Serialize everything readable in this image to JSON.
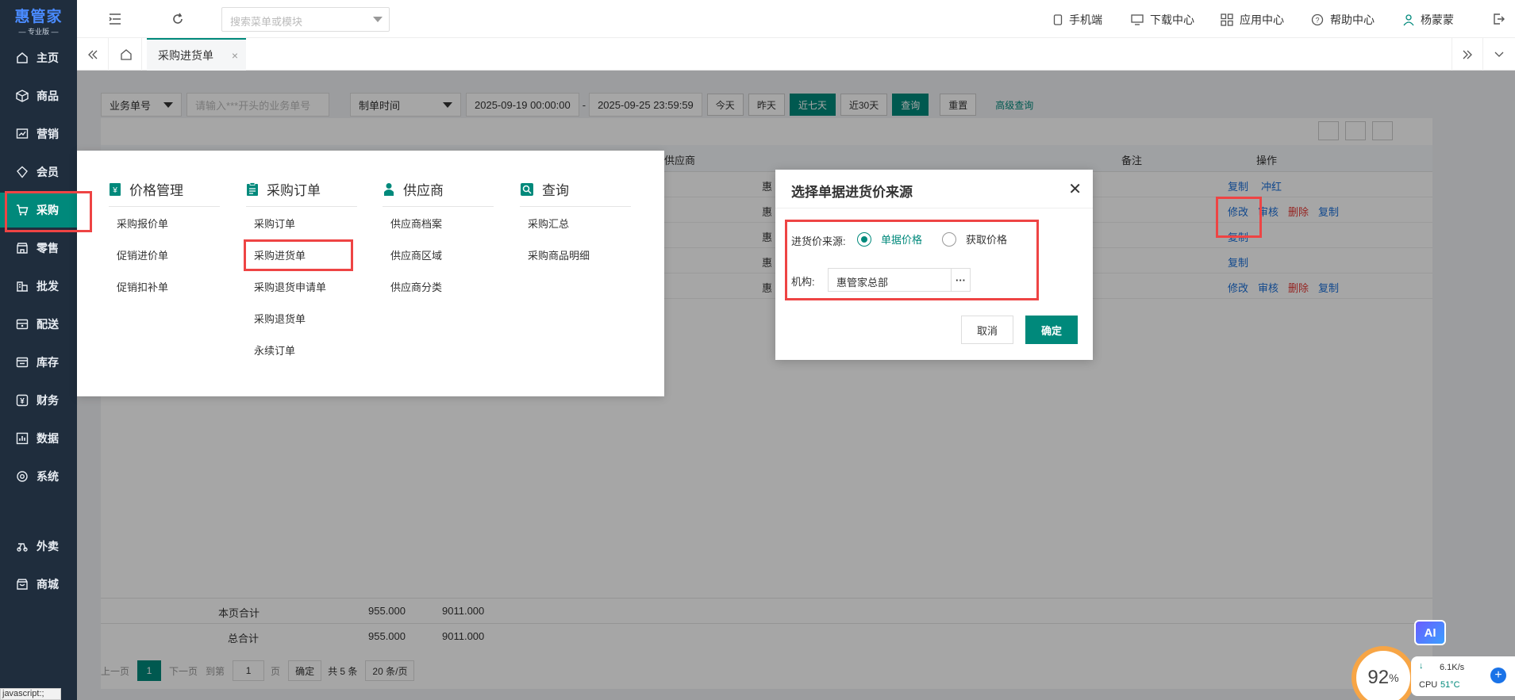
{
  "app": {
    "logo_main": "惠管家",
    "logo_sub": "— 专业版 —"
  },
  "sidebar": {
    "items": [
      {
        "label": "主页",
        "icon": "home-icon"
      },
      {
        "label": "商品",
        "icon": "box-icon"
      },
      {
        "label": "营销",
        "icon": "chart-icon"
      },
      {
        "label": "会员",
        "icon": "diamond-icon"
      },
      {
        "label": "采购",
        "icon": "cart-icon",
        "active": true
      },
      {
        "label": "零售",
        "icon": "shop-icon"
      },
      {
        "label": "批发",
        "icon": "building-icon"
      },
      {
        "label": "配送",
        "icon": "truck-icon"
      },
      {
        "label": "库存",
        "icon": "warehouse-icon"
      },
      {
        "label": "财务",
        "icon": "finance-icon"
      },
      {
        "label": "数据",
        "icon": "data-icon"
      },
      {
        "label": "系统",
        "icon": "settings-icon"
      },
      {
        "label": "外卖",
        "icon": "delivery-icon"
      },
      {
        "label": "商城",
        "icon": "mall-icon"
      }
    ]
  },
  "topbar": {
    "search_placeholder": "搜索菜单或模块",
    "mobile": "手机端",
    "downloads": "下载中心",
    "apps": "应用中心",
    "help": "帮助中心",
    "user": "杨蒙蒙"
  },
  "tabs": {
    "active": "采购进货单"
  },
  "filters": {
    "bill_field": "业务单号",
    "bill_placeholder": "请输入***开头的业务单号",
    "time_field": "制单时间",
    "start": "2025-09-19 00:00:00",
    "dash": "-",
    "end": "2025-09-25 23:59:59",
    "today": "今天",
    "yesterday": "昨天",
    "last7": "近七天",
    "last30": "近30天",
    "query": "查询",
    "reset": "重置",
    "advanced": "高级查询"
  },
  "table": {
    "headers": {
      "supplier": "供应商",
      "remark": "备注",
      "ops": "操作"
    },
    "row_prefix": "惠",
    "ops": {
      "copy": "复制",
      "reverse": "冲红",
      "edit": "修改",
      "audit": "审核",
      "delete": "删除"
    },
    "page_total_label": "本页合计",
    "grand_total_label": "总合计",
    "qty_total": "955.000",
    "amount_total": "9011.000"
  },
  "pager": {
    "prev": "上一页",
    "page": "1",
    "next": "下一页",
    "goto": "到第",
    "goto_val": "1",
    "page_unit": "页",
    "confirm": "确定",
    "total": "共 5 条",
    "size": "20 条/页"
  },
  "mega_menu": {
    "columns": [
      {
        "title": "价格管理",
        "icon": "price-icon",
        "items": [
          "采购报价单",
          "促销进价单",
          "促销扣补单"
        ]
      },
      {
        "title": "采购订单",
        "icon": "clipboard-icon",
        "items": [
          "采购订单",
          "采购进货单",
          "采购退货申请单",
          "采购退货单",
          "永续订单"
        ]
      },
      {
        "title": "供应商",
        "icon": "person-icon",
        "items": [
          "供应商档案",
          "供应商区域",
          "供应商分类"
        ]
      },
      {
        "title": "查询",
        "icon": "search-icon",
        "items": [
          "采购汇总",
          "采购商品明细"
        ]
      }
    ]
  },
  "modal": {
    "title": "选择单据进货价来源",
    "source_label": "进货价来源:",
    "opt_bill": "单据价格",
    "opt_fetch": "获取价格",
    "org_label": "机构:",
    "org_value": "惠管家总部",
    "more": "···",
    "cancel": "取消",
    "ok": "确定"
  },
  "widgets": {
    "ai": "AI",
    "gauge_value": "92",
    "gauge_unit": "%",
    "net_speed": "6.1K/s",
    "cpu_label": "CPU",
    "cpu_temp": "51°C",
    "status_text": "javascript:;"
  },
  "colors": {
    "accent": "#00897b",
    "sidebar_bg": "#1f2d3d",
    "highlight": "#ee4444",
    "link": "#1a6fd9",
    "danger": "#e53935"
  }
}
